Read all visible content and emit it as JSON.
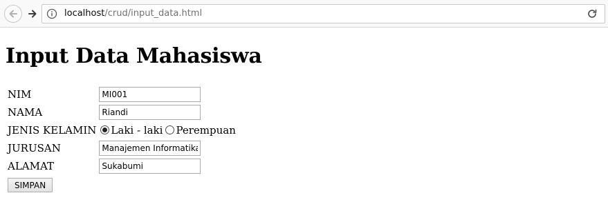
{
  "browser": {
    "url_host": "localhost",
    "url_path": "/crud/input_data.html"
  },
  "page": {
    "title": "Input Data Mahasiswa"
  },
  "form": {
    "nim": {
      "label": "NIM",
      "value": "MI001"
    },
    "nama": {
      "label": "NAMA",
      "value": "Riandi"
    },
    "jenis_kelamin": {
      "label": "JENIS KELAMIN",
      "options": [
        {
          "label": "Laki - laki",
          "checked": true
        },
        {
          "label": "Perempuan",
          "checked": false
        }
      ]
    },
    "jurusan": {
      "label": "JURUSAN",
      "value": "Manajemen Informatika"
    },
    "alamat": {
      "label": "ALAMAT",
      "value": "Sukabumi"
    },
    "submit_label": "SIMPAN"
  }
}
